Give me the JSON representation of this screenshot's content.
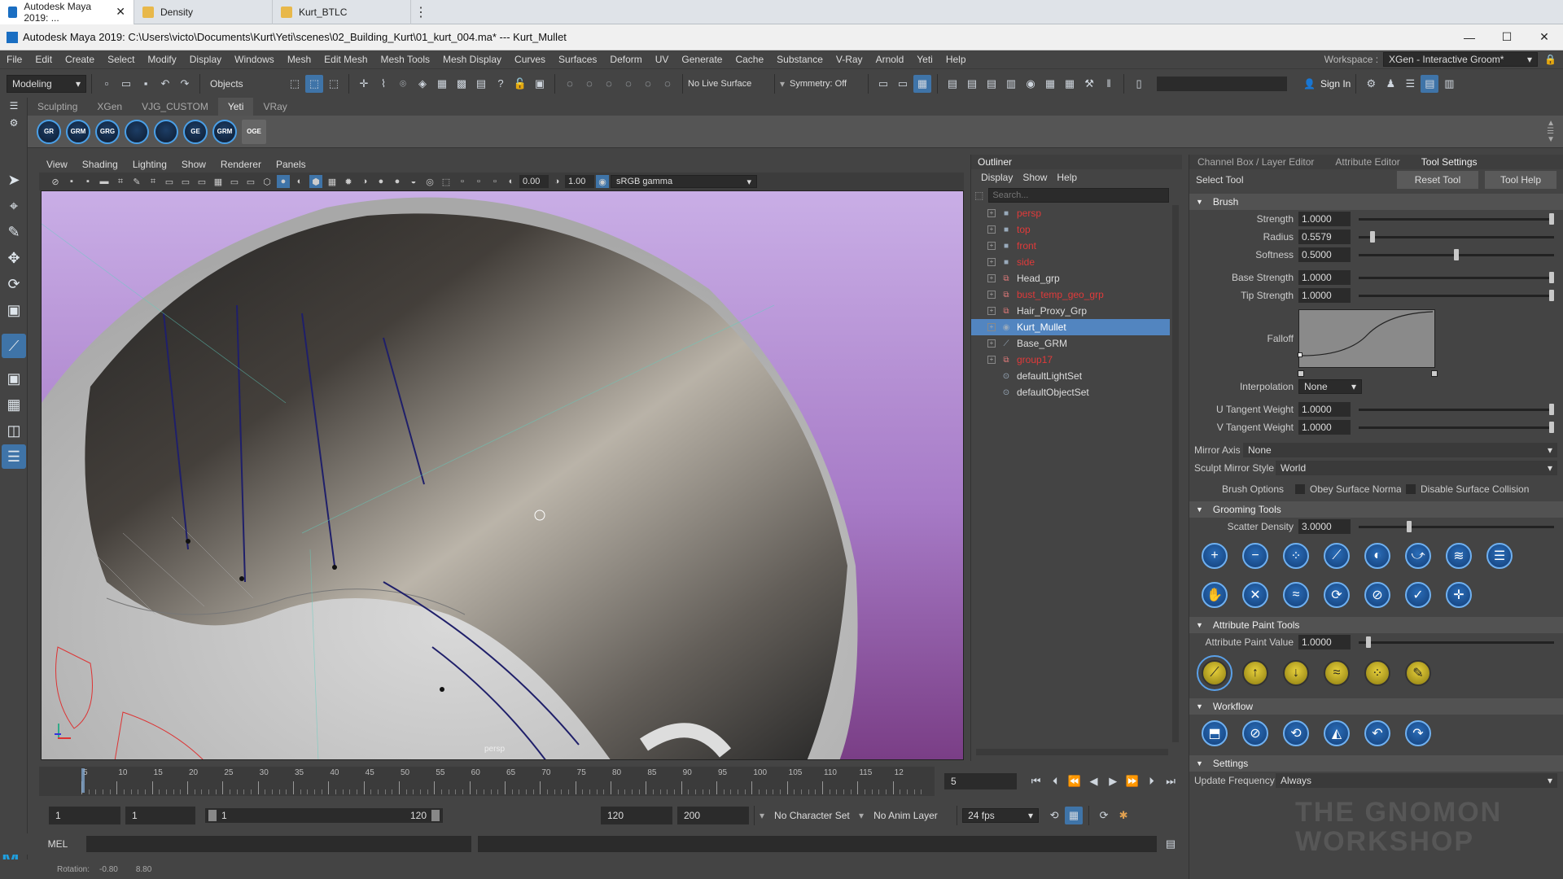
{
  "browser_tabs": [
    {
      "label": "Autodesk Maya 2019: ...",
      "active": true,
      "color": "#1a6ec2"
    },
    {
      "label": "Density",
      "active": false,
      "color": "#e8b84a"
    },
    {
      "label": "Kurt_BTLC",
      "active": false,
      "color": "#e8b84a"
    }
  ],
  "window": {
    "title": "Autodesk Maya 2019: C:\\Users\\victo\\Documents\\Kurt\\Yeti\\scenes\\02_Building_Kurt\\01_kurt_004.ma*  ---  Kurt_Mullet",
    "minimize": "—",
    "maximize": "☐",
    "close": "✕"
  },
  "menubar": [
    "File",
    "Edit",
    "Create",
    "Select",
    "Modify",
    "Display",
    "Windows",
    "Mesh",
    "Edit Mesh",
    "Mesh Tools",
    "Mesh Display",
    "Curves",
    "Surfaces",
    "Deform",
    "UV",
    "Generate",
    "Cache",
    "Substance",
    "V-Ray",
    "Arnold",
    "Yeti",
    "Help"
  ],
  "workspace": {
    "label": "Workspace :",
    "value": "XGen - Interactive Groom*"
  },
  "statusline": {
    "menuset": "Modeling",
    "objects": "Objects",
    "live_surface": "No Live Surface",
    "symmetry": "Symmetry: Off",
    "sign_in": "Sign In"
  },
  "shelf_tabs": [
    {
      "label": "Sculpting",
      "active": false
    },
    {
      "label": "XGen",
      "active": false
    },
    {
      "label": "VJG_CUSTOM",
      "active": false
    },
    {
      "label": "Yeti",
      "active": true
    },
    {
      "label": "VRay",
      "active": false
    }
  ],
  "shelf_icons": [
    "GR",
    "GRM",
    "GRG",
    "",
    "",
    "GE",
    "GRM",
    "OGE"
  ],
  "viewport": {
    "menu": [
      "View",
      "Shading",
      "Lighting",
      "Show",
      "Renderer",
      "Panels"
    ],
    "exposure": "0.00",
    "gamma": "1.00",
    "colorspace": "sRGB gamma",
    "camera_label": "persp"
  },
  "outliner": {
    "title": "Outliner",
    "menu": [
      "Display",
      "Show",
      "Help"
    ],
    "search_placeholder": "Search...",
    "items": [
      {
        "label": "persp",
        "color": "#e03a3a",
        "icon": "camera-icon",
        "selected": false,
        "expandable": true
      },
      {
        "label": "top",
        "color": "#e03a3a",
        "icon": "camera-icon",
        "selected": false,
        "expandable": true
      },
      {
        "label": "front",
        "color": "#e03a3a",
        "icon": "camera-icon",
        "selected": false,
        "expandable": true
      },
      {
        "label": "side",
        "color": "#e03a3a",
        "icon": "camera-icon",
        "selected": false,
        "expandable": true
      },
      {
        "label": "Head_grp",
        "color": "#dddddd",
        "icon": "group-icon",
        "selected": false,
        "expandable": true
      },
      {
        "label": "bust_temp_geo_grp",
        "color": "#e03a3a",
        "icon": "group-icon",
        "selected": false,
        "expandable": true
      },
      {
        "label": "Hair_Proxy_Grp",
        "color": "#dddddd",
        "icon": "group-icon",
        "selected": false,
        "expandable": true
      },
      {
        "label": "Kurt_Mullet",
        "color": "#ffffff",
        "icon": "yeti-icon",
        "selected": true,
        "expandable": true
      },
      {
        "label": "Base_GRM",
        "color": "#dddddd",
        "icon": "groom-icon",
        "selected": false,
        "expandable": true
      },
      {
        "label": "group17",
        "color": "#e03a3a",
        "icon": "group-icon",
        "selected": false,
        "expandable": true
      },
      {
        "label": "defaultLightSet",
        "color": "#dddddd",
        "icon": "set-icon",
        "selected": false,
        "expandable": false
      },
      {
        "label": "defaultObjectSet",
        "color": "#dddddd",
        "icon": "set-icon",
        "selected": false,
        "expandable": false
      }
    ]
  },
  "right_panel": {
    "tabs": [
      {
        "label": "Channel Box / Layer Editor",
        "active": false
      },
      {
        "label": "Attribute Editor",
        "active": false
      },
      {
        "label": "Tool Settings",
        "active": true
      }
    ],
    "tool_name": "Select Tool",
    "reset_tool": "Reset Tool",
    "tool_help": "Tool Help",
    "brush": {
      "title": "Brush",
      "strength": {
        "label": "Strength",
        "value": "1.0000",
        "level": 1.0
      },
      "radius": {
        "label": "Radius",
        "value": "0.5579",
        "level": 0.06
      },
      "softness": {
        "label": "Softness",
        "value": "0.5000",
        "level": 0.5
      },
      "base_strength": {
        "label": "Base Strength",
        "value": "1.0000",
        "level": 1.0
      },
      "tip_strength": {
        "label": "Tip Strength",
        "value": "1.0000",
        "level": 1.0
      },
      "falloff": "Falloff",
      "interpolation": {
        "label": "Interpolation",
        "value": "None"
      },
      "u_tangent": {
        "label": "U Tangent Weight",
        "value": "1.0000",
        "level": 1.0
      },
      "v_tangent": {
        "label": "V Tangent Weight",
        "value": "1.0000",
        "level": 1.0
      }
    },
    "mirror_axis": {
      "label": "Mirror Axis",
      "value": "None"
    },
    "sculpt_mirror": {
      "label": "Sculpt Mirror Style",
      "value": "World"
    },
    "brush_options": {
      "label": "Brush Options",
      "obey": "Obey Surface Norma",
      "disable": "Disable Surface Collision"
    },
    "grooming": {
      "title": "Grooming Tools",
      "scatter": {
        "label": "Scatter Density",
        "value": "3.0000",
        "level": 0.25
      },
      "row1": [
        "+",
        "−",
        "⁘",
        "⟋",
        "◐",
        "⤻",
        "≋",
        "☰"
      ],
      "row2": [
        "✋",
        "✕",
        "≈",
        "⟳",
        "⊘",
        "✓",
        "✛"
      ]
    },
    "attr_paint": {
      "title": "Attribute Paint Tools",
      "value": {
        "label": "Attribute Paint Value",
        "value": "1.0000",
        "level": 0.04
      },
      "icons": [
        "⟋",
        "↑",
        "↓",
        "≈",
        "⁘",
        "✎"
      ]
    },
    "workflow": {
      "title": "Workflow",
      "icons": [
        "⬒",
        "⊘",
        "⟲",
        "◭",
        "↶",
        "↷"
      ]
    },
    "settings": {
      "title": "Settings",
      "update": {
        "label": "Update Frequency",
        "value": "Always"
      }
    },
    "watermark": "THE GNOMON WORKSHOP"
  },
  "timeline": {
    "ticks": [
      "5",
      "10",
      "15",
      "20",
      "25",
      "30",
      "35",
      "40",
      "45",
      "50",
      "55",
      "60",
      "65",
      "70",
      "75",
      "80",
      "85",
      "90",
      "95",
      "100",
      "105",
      "110",
      "115",
      "12"
    ],
    "current": "5"
  },
  "range": {
    "start": "1",
    "playback_start": "1",
    "slider_start": "1",
    "slider_end": "120",
    "playback_end": "120",
    "end": "200",
    "character_set": "No Character Set",
    "anim_layer": "No Anim Layer",
    "fps": "24 fps"
  },
  "mel": {
    "label": "MEL"
  },
  "helpline": {
    "label": "Rotation:",
    "x": "-0.80",
    "y": "8.80"
  }
}
